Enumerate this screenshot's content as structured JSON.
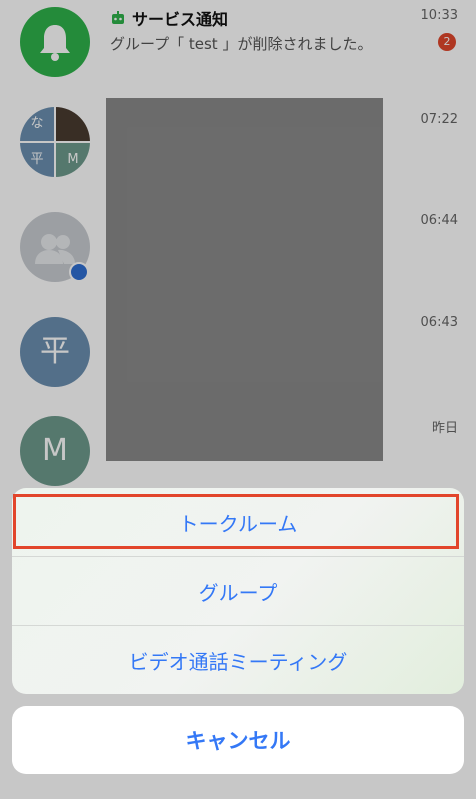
{
  "chats": [
    {
      "title": "サービス通知",
      "subtitle": "グループ「 test 」が削除されました。",
      "time": "10:33",
      "badge": "2",
      "avatar_icon": "bell-icon",
      "title_icon": "robot-icon"
    },
    {
      "time": "07:22",
      "avatar_quadrants": [
        "な",
        "",
        "平",
        "M"
      ]
    },
    {
      "time": "06:44",
      "avatar_icon": "group-people-icon",
      "badge_icon": "group-badge-icon"
    },
    {
      "time": "06:43",
      "avatar_initial": "平"
    },
    {
      "time": "昨日",
      "avatar_initial": "M"
    }
  ],
  "action_sheet": {
    "options": [
      "トークルーム",
      "グループ",
      "ビデオ通話ミーティング"
    ],
    "cancel_label": "キャンセル"
  },
  "colors": {
    "accent_blue": "#3478f6",
    "highlight_red": "#e2452b",
    "service_green": "#2fb24b",
    "badge_red": "#e0472c"
  }
}
